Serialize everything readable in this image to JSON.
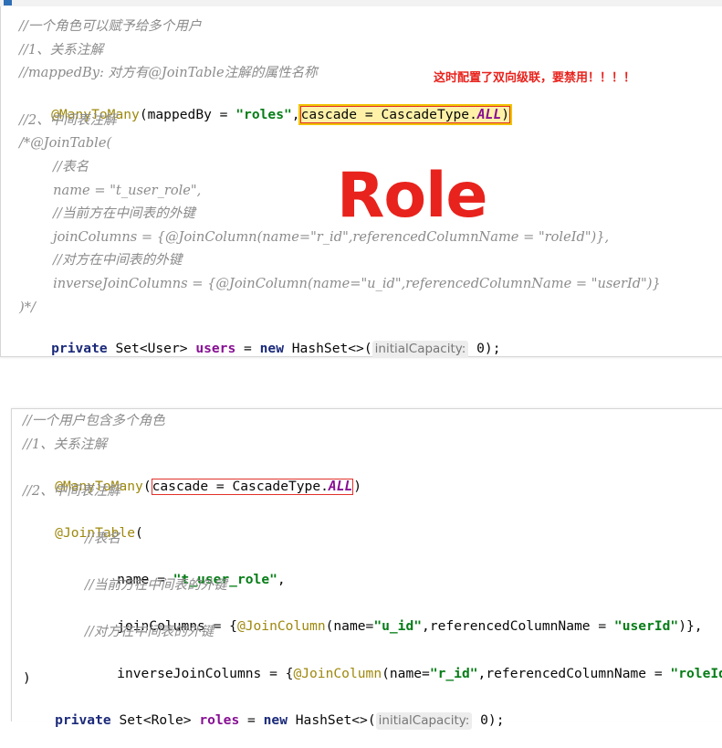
{
  "top_strip": {
    "text": ""
  },
  "role_panel": {
    "lines": {
      "c1": "//一个角色可以赋予给多个用户",
      "c2": "//1、关系注解",
      "c3": "//mappedBy: 对方有@JoinTable注解的属性名称",
      "anno": "@ManyToMany",
      "paren_open": "(",
      "mapped_key": "mappedBy = ",
      "mapped_val": "\"roles\"",
      "comma": ",",
      "cascade_prefix": "cascade = CascadeType.",
      "cascade_all": "ALL",
      "paren_close": ")",
      "c4": "//2、中间表注解",
      "c5": "/*@JoinTable(",
      "c6": "        //表名",
      "c7": "        name = \"t_user_role\",",
      "c8": "        //当前方在中间表的外键",
      "c9": "        joinColumns = {@JoinColumn(name=\"r_id\",referencedColumnName = \"roleId\")},",
      "c10": "        //对方在中间表的外键",
      "c11": "        inverseJoinColumns = {@JoinColumn(name=\"u_id\",referencedColumnName = \"userId\")}",
      "c12": ")*/",
      "private": "private",
      "set_type": " Set<User> ",
      "field": "users",
      "assign": " = ",
      "new": "new",
      "hashset": " HashSet<>(",
      "hint": "initialCapacity:",
      "zero": " 0);"
    },
    "warning": "这时配置了双向级联，要禁用！！！！",
    "overlay_title": "Role"
  },
  "user_panel": {
    "lines": {
      "c1": "//一个用户包含多个角色",
      "c2": "//1、关系注解",
      "anno": "@ManyToMany",
      "paren_open": "(",
      "cascade_prefix": "cascade = CascadeType.",
      "cascade_all": "ALL",
      "paren_close": ")",
      "c3": "//2、中间表注解",
      "jt": "@JoinTable",
      "jt_open": "(",
      "c4": "//表名",
      "name_key": "name = ",
      "name_val": "\"t_user_role\"",
      "name_end": ",",
      "c5": "//当前方在中间表的外键",
      "jc_key": "joinColumns = {",
      "jc_anno": "@JoinColumn",
      "jc_open": "(name=",
      "jc_name": "\"u_id\"",
      "jc_mid": ",referencedColumnName = ",
      "jc_ref": "\"userId\"",
      "jc_end": ")},",
      "c6": "//对方在中间表的外键",
      "ijc_key": "inverseJoinColumns = {",
      "ijc_anno": "@JoinColumn",
      "ijc_open": "(name=",
      "ijc_name": "\"r_id\"",
      "ijc_mid": ",referencedColumnName = ",
      "ijc_ref": "\"roleId\"",
      "ijc_end": ")}",
      "close": ")",
      "private": "private",
      "set_type": " Set<Role> ",
      "field": "roles",
      "assign": " = ",
      "new": "new",
      "hashset": " HashSet<>(",
      "hint": "initialCapacity:",
      "zero": " 0);"
    }
  },
  "colors": {
    "comment": "#8c8c8c",
    "annotation": "#9e880d",
    "string": "#067d17",
    "keyword": "#1b2a7a",
    "field": "#871094",
    "highlight_yellow": "#fff2a8",
    "red_box": "#e1302b",
    "warning_red": "#e8221c"
  }
}
